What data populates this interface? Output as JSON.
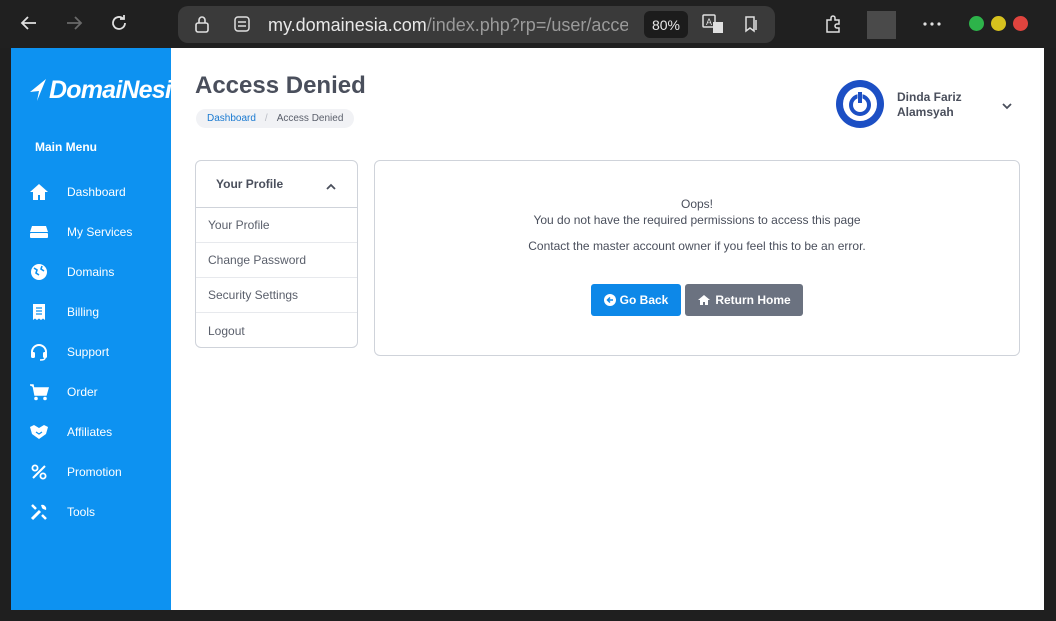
{
  "browser": {
    "url_domain": "my.domainesia.com",
    "url_path": "/index.php?rp=/user/access",
    "zoom": "80%"
  },
  "sidebar": {
    "logo_text": "DomaiNesia",
    "menu_title": "Main Menu",
    "items": [
      {
        "label": "Dashboard",
        "icon": "home-icon"
      },
      {
        "label": "My Services",
        "icon": "server-icon"
      },
      {
        "label": "Domains",
        "icon": "globe-icon"
      },
      {
        "label": "Billing",
        "icon": "receipt-icon"
      },
      {
        "label": "Support",
        "icon": "headset-icon"
      },
      {
        "label": "Order",
        "icon": "cart-icon"
      },
      {
        "label": "Affiliates",
        "icon": "handshake-icon"
      },
      {
        "label": "Promotion",
        "icon": "percent-icon"
      },
      {
        "label": "Tools",
        "icon": "tools-icon"
      }
    ]
  },
  "header": {
    "title": "Access Denied",
    "breadcrumb": {
      "home": "Dashboard",
      "current": "Access Denied"
    },
    "user_first": "Dinda Fariz",
    "user_last": "Alamsyah"
  },
  "profile_menu": {
    "title": "Your Profile",
    "items": [
      "Your Profile",
      "Change Password",
      "Security Settings",
      "Logout"
    ]
  },
  "message": {
    "line1": "Oops!",
    "line2": "You do not have the required permissions to access this page",
    "line3": "Contact the master account owner if you feel this to be an error.",
    "go_back": "Go Back",
    "return_home": "Return Home"
  },
  "colors": {
    "sidebar": "#0d92f1",
    "primary_button": "#0d88e8",
    "secondary_button": "#6b7280",
    "avatar": "#1c4fc4"
  }
}
